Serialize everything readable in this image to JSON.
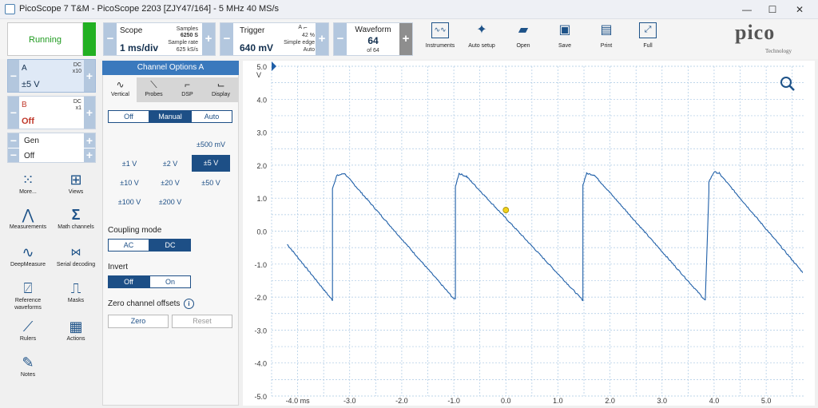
{
  "window": {
    "title": "PicoScope 7 T&M  - PicoScope 2203 [ZJY47/164] - 5 MHz 40 MS/s",
    "minimize": "—",
    "maximize": "☐",
    "close": "✕"
  },
  "toolbar": {
    "run_label": "Running",
    "scope": {
      "label": "Scope",
      "timebase": "1 ms/div",
      "samples_label": "Samples",
      "samples_value": "6250 S",
      "rate_label": "Sample rate",
      "rate_value": "625 kS/s"
    },
    "trigger": {
      "label": "Trigger",
      "level": "640 mV",
      "channel": "A",
      "percent": "42 %",
      "type": "Simple edge",
      "mode": "Auto"
    },
    "waveform": {
      "label": "Waveform",
      "index": "64",
      "of": "of 64"
    },
    "tools": {
      "instruments": "Instruments",
      "auto_setup": "Auto setup",
      "open": "Open",
      "save": "Save",
      "print": "Print",
      "full": "Full"
    },
    "logo": "pico",
    "logo_sub": "Technology"
  },
  "channels": {
    "a": {
      "name": "A",
      "coupling": "DC",
      "probe": "x10",
      "range": "±5 V"
    },
    "b": {
      "name": "B",
      "coupling": "DC",
      "probe": "x1",
      "range": "Off"
    },
    "gen": {
      "name": "Gen",
      "state": "Off"
    }
  },
  "left_tools": {
    "more": "More...",
    "views": "Views",
    "measurements": "Measurements",
    "math": "Math channels",
    "deepmeasure": "DeepMeasure",
    "serial": "Serial decoding",
    "reference_1": "Reference",
    "reference_2": "waveforms",
    "masks": "Masks",
    "rulers": "Rulers",
    "actions": "Actions",
    "notes": "Notes"
  },
  "panel": {
    "title": "Channel Options A",
    "tabs": [
      "Vertical",
      "Probes",
      "DSP",
      "Display"
    ],
    "mode": [
      "Off",
      "Manual",
      "Auto"
    ],
    "mode_selected": "Manual",
    "ranges": [
      "±500 mV",
      "±1 V",
      "±2 V",
      "±5 V",
      "±10 V",
      "±20 V",
      "±50 V",
      "±100 V",
      "±200 V"
    ],
    "range_selected": "±5 V",
    "coupling_label": "Coupling mode",
    "coupling": [
      "AC",
      "DC"
    ],
    "coupling_selected": "DC",
    "invert_label": "Invert",
    "invert": [
      "Off",
      "On"
    ],
    "invert_selected": "Off",
    "zero_label": "Zero channel offsets",
    "zero_btn": "Zero",
    "reset_btn": "Reset"
  },
  "chart_data": {
    "type": "line",
    "title": "",
    "xlabel": "ms",
    "ylabel": "V",
    "xlim": [
      -4.5,
      5.75
    ],
    "ylim": [
      -5.0,
      5.0
    ],
    "yticks": [
      "5.0",
      "4.0",
      "3.0",
      "2.0",
      "1.0",
      "0.0",
      "-1.0",
      "-2.0",
      "-3.0",
      "-4.0",
      "-5.0"
    ],
    "xticks": [
      "-4.0 ms",
      "-3.0",
      "-2.0",
      "-1.0",
      "0.0",
      "1.0",
      "2.0",
      "3.0",
      "4.0",
      "5.0"
    ],
    "grid": true,
    "trigger_point": {
      "x": 0.0,
      "y": 0.64
    },
    "series": [
      {
        "color": "#1f5fa8",
        "x": [
          -4.2,
          -3.33,
          -3.33,
          -3.25,
          -3.1,
          -1.0,
          -0.97,
          -0.97,
          -0.9,
          -0.75,
          1.48,
          1.48,
          1.55,
          1.7,
          3.83,
          3.9,
          3.9,
          4.0,
          4.1,
          5.7
        ],
        "y": [
          -0.4,
          -2.1,
          1.3,
          1.68,
          1.75,
          -2.05,
          -2.05,
          1.35,
          1.75,
          1.65,
          -2.1,
          1.4,
          1.75,
          1.7,
          -2.1,
          1.2,
          1.5,
          1.8,
          1.75,
          -1.25
        ]
      }
    ]
  }
}
